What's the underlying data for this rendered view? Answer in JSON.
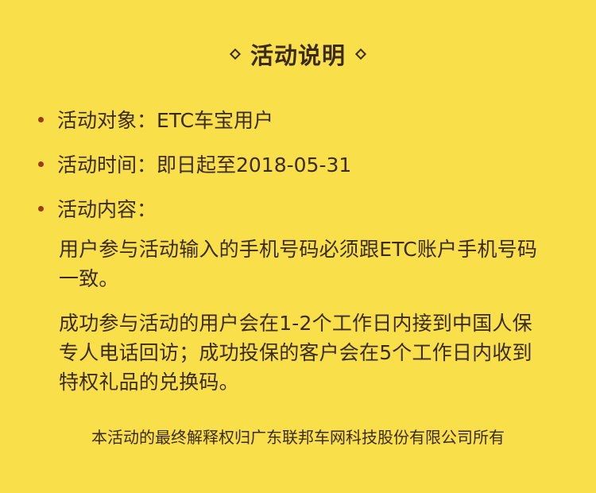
{
  "header": {
    "title": "活动说明"
  },
  "details": {
    "items": [
      "活动对象：ETC车宝用户",
      "活动时间：即日起至2018-05-31",
      "活动内容："
    ],
    "paragraphs": [
      "用户参与活动输入的手机号码必须跟ETC账户手机号码一致。",
      "成功参与活动的用户会在1-2个工作日内接到中国人保专人电话回访；成功投保的客户会在5个工作日内收到特权礼品的兑换码。"
    ]
  },
  "footer": {
    "note": "本活动的最终解释权归广东联邦车网科技股份有限公司所有"
  },
  "colors": {
    "background": "#f9df49",
    "text": "#3b2b1f",
    "bullet": "#9b3b19"
  }
}
